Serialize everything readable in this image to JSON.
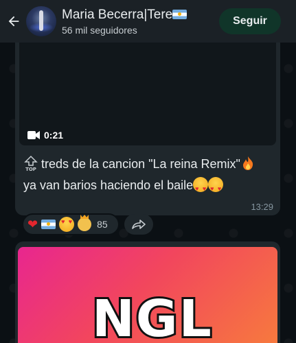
{
  "header": {
    "back_icon": "arrow-left-icon",
    "channel_name": "Maria Becerra|Tere",
    "followers": "56 mil seguidores",
    "follow_label": "Seguir"
  },
  "message": {
    "video_duration": "0:21",
    "text_line1": "treds de la cancion \"La reina Remix\"",
    "text_line2": "ya van barios haciendo el baile",
    "time": "13:29"
  },
  "reactions": {
    "count": "85",
    "items": [
      "heart",
      "argentina-flag",
      "heart-eyes",
      "crown-face"
    ]
  },
  "second_message": {
    "image_text": "NGL"
  },
  "colors": {
    "header_bg": "#1b2126",
    "bubble_bg": "#1f272c",
    "follow_bg": "#103529",
    "chat_bg": "#0b1014"
  }
}
